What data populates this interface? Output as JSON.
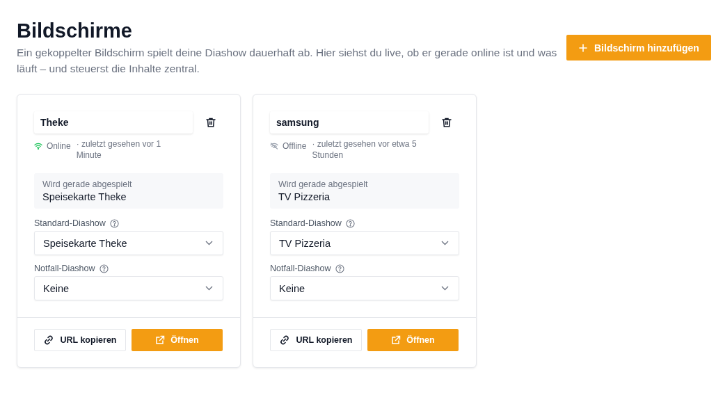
{
  "header": {
    "title": "Bildschirme",
    "description": "Ein gekoppelter Bildschirm spielt deine Diashow dauerhaft ab. Hier siehst du live, ob er gerade online ist und was läuft – und steuerst die Inhalte zentral.",
    "add_button": "Bildschirm hinzufügen"
  },
  "screens": [
    {
      "name": "Theke",
      "online": true,
      "status": "Online",
      "last_seen": "· zuletzt gesehen vor 1 Minute",
      "now_playing_label": "Wird gerade abgespielt",
      "now_playing": "Speisekarte Theke",
      "default_label": "Standard-Diashow",
      "default_value": "Speisekarte Theke",
      "fallback_label": "Notfall-Diashow",
      "fallback_value": "Keine",
      "copy_button": "URL kopieren",
      "open_button": "Öffnen"
    },
    {
      "name": "samsung",
      "online": false,
      "status": "Offline",
      "last_seen": "· zuletzt gesehen vor etwa 5 Stunden",
      "now_playing_label": "Wird gerade abgespielt",
      "now_playing": "TV Pizzeria",
      "default_label": "Standard-Diashow",
      "default_value": "TV Pizzeria",
      "fallback_label": "Notfall-Diashow",
      "fallback_value": "Keine",
      "copy_button": "URL kopieren",
      "open_button": "Öffnen"
    }
  ]
}
